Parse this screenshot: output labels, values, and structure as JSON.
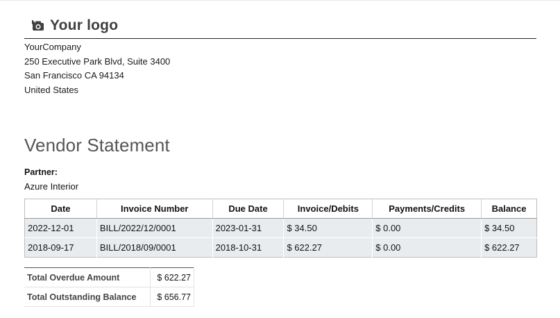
{
  "company": {
    "logo_text": "Your logo",
    "name": "YourCompany",
    "address_line1": "250 Executive Park Blvd, Suite 3400",
    "address_line2": "San Francisco CA 94134",
    "country": "United States"
  },
  "document": {
    "title": "Vendor Statement",
    "partner_label": "Partner:",
    "partner_name": "Azure Interior"
  },
  "table": {
    "columns": [
      "Date",
      "Invoice Number",
      "Due Date",
      "Invoice/Debits",
      "Payments/Credits",
      "Balance"
    ],
    "rows": [
      [
        "2022-12-01",
        "BILL/2022/12/0001",
        "2023-01-31",
        "$ 34.50",
        "$ 0.00",
        "$ 34.50"
      ],
      [
        "2018-09-17",
        "BILL/2018/09/0001",
        "2018-10-31",
        "$ 622.27",
        "$ 0.00",
        "$ 622.27"
      ]
    ]
  },
  "totals": {
    "overdue_label": "Total Overdue Amount",
    "overdue_value": "$ 622.27",
    "outstanding_label": "Total Outstanding Balance",
    "outstanding_value": "$ 656.77"
  },
  "icons": {
    "logo": "camera-icon"
  },
  "colors": {
    "title": "#555555",
    "row_background": "#e9ecef",
    "logo": "#3f3f3f"
  }
}
